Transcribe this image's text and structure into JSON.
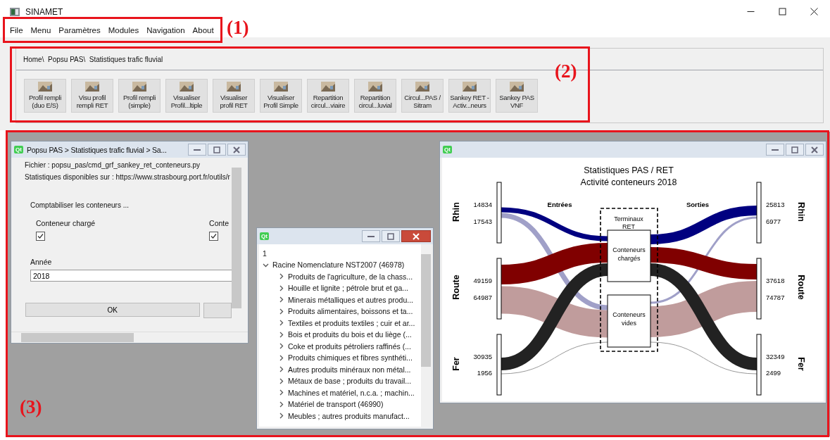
{
  "window": {
    "title": "SINAMET"
  },
  "menu": [
    {
      "label": "File"
    },
    {
      "label": "Menu"
    },
    {
      "label": "Paramètres"
    },
    {
      "label": "Modules"
    },
    {
      "label": "Navigation"
    },
    {
      "label": "About"
    }
  ],
  "breadcrumb": "Home\\  Popsu PAS\\  Statistiques trafic fluvial",
  "toolbar_buttons": [
    {
      "lines": [
        "Profil rempli",
        "(duo E/S)"
      ]
    },
    {
      "lines": [
        "Visu profil",
        "rempli RET"
      ]
    },
    {
      "lines": [
        "Profil rempli",
        "(simple)"
      ]
    },
    {
      "lines": [
        "Visualiser",
        "Profil...ltiple"
      ]
    },
    {
      "lines": [
        "Visualiser",
        "profil RET"
      ]
    },
    {
      "lines": [
        "Visualiser",
        "Profil Simple"
      ]
    },
    {
      "lines": [
        "Repartition",
        "circul...viaire"
      ]
    },
    {
      "lines": [
        "Repartition",
        "circul...luvial"
      ]
    },
    {
      "lines": [
        "Circul...PAS /",
        "Sitram"
      ]
    },
    {
      "lines": [
        "Sankey RET -",
        "Activ...neurs"
      ]
    },
    {
      "lines": [
        "Sankey PAS",
        "VNF"
      ]
    }
  ],
  "form_window": {
    "logo": "Qt",
    "title": "Popsu PAS > Statistiques trafic fluvial > Sa...",
    "active": false,
    "file": "Fichier : popsu_pas/cmd_grf_sankey_ret_conteneurs.py",
    "source": "Statistiques disponibles sur : https://www.strasbourg.port.fr/outils/r",
    "section": "Comptabiliser les conteneurs ...",
    "checkboxes": [
      {
        "label": "Conteneur chargé",
        "checked": true
      },
      {
        "label": "Conte",
        "checked": true
      }
    ],
    "year_label": "Année",
    "year_value": "2018",
    "ok_button": "OK"
  },
  "tree_window": {
    "logo": "Qt",
    "active": true,
    "header": "1",
    "root": {
      "label": "Racine Nomenclature NST2007 (46978)",
      "expanded": true,
      "children": [
        {
          "label": "Produits de l'agriculture, de la chass...",
          "expanded": false
        },
        {
          "label": "Houille et lignite ; pétrole brut et ga...",
          "expanded": false
        },
        {
          "label": "Minerais métalliques et autres produ...",
          "expanded": false
        },
        {
          "label": "Produits alimentaires, boissons et ta...",
          "expanded": false
        },
        {
          "label": "Textiles et produits textiles ; cuir et ar...",
          "expanded": false
        },
        {
          "label": "Bois et produits du bois et du liège (...",
          "expanded": false
        },
        {
          "label": "Coke et produits pétroliers raffinés (...",
          "expanded": false
        },
        {
          "label": "Produits chimiques et fibres synthéti...",
          "expanded": false
        },
        {
          "label": "Autres produits minéraux non métal...",
          "expanded": false
        },
        {
          "label": "Métaux de base ; produits du travail...",
          "expanded": false
        },
        {
          "label": "Machines et matériel, n.c.a. ; machin...",
          "expanded": false
        },
        {
          "label": "Matériel de transport (46990)",
          "expanded": false
        },
        {
          "label": "Meubles ; autres produits manufact...",
          "expanded": false
        }
      ]
    }
  },
  "sankey_window": {
    "logo": "Qt",
    "active": false,
    "title_lines": [
      "Statistiques PAS / RET",
      "Activité conteneurs 2018"
    ],
    "inputs_header": "Entrées",
    "outputs_header": "Sorties",
    "terminal_lines": [
      "Terminaux",
      "RET"
    ],
    "center_boxes": [
      {
        "lines": [
          "Conteneurs",
          "chargés"
        ]
      },
      {
        "lines": [
          "Conteneurs",
          "vides"
        ]
      }
    ],
    "left_nodes": [
      {
        "name": "Rhin",
        "values": [
          "14834",
          "17543"
        ]
      },
      {
        "name": "Route",
        "values": [
          "49159",
          "64987"
        ]
      },
      {
        "name": "Fer",
        "values": [
          "30935",
          "1956"
        ]
      }
    ],
    "right_nodes": [
      {
        "name": "Rhin",
        "values": [
          "25813",
          "6977"
        ]
      },
      {
        "name": "Route",
        "values": [
          "37618",
          "74787"
        ]
      },
      {
        "name": "Fer",
        "values": [
          "32349",
          "2499"
        ]
      }
    ]
  },
  "annotations": [
    {
      "label": "(1)"
    },
    {
      "label": "(2)"
    },
    {
      "label": "(3)"
    }
  ]
}
